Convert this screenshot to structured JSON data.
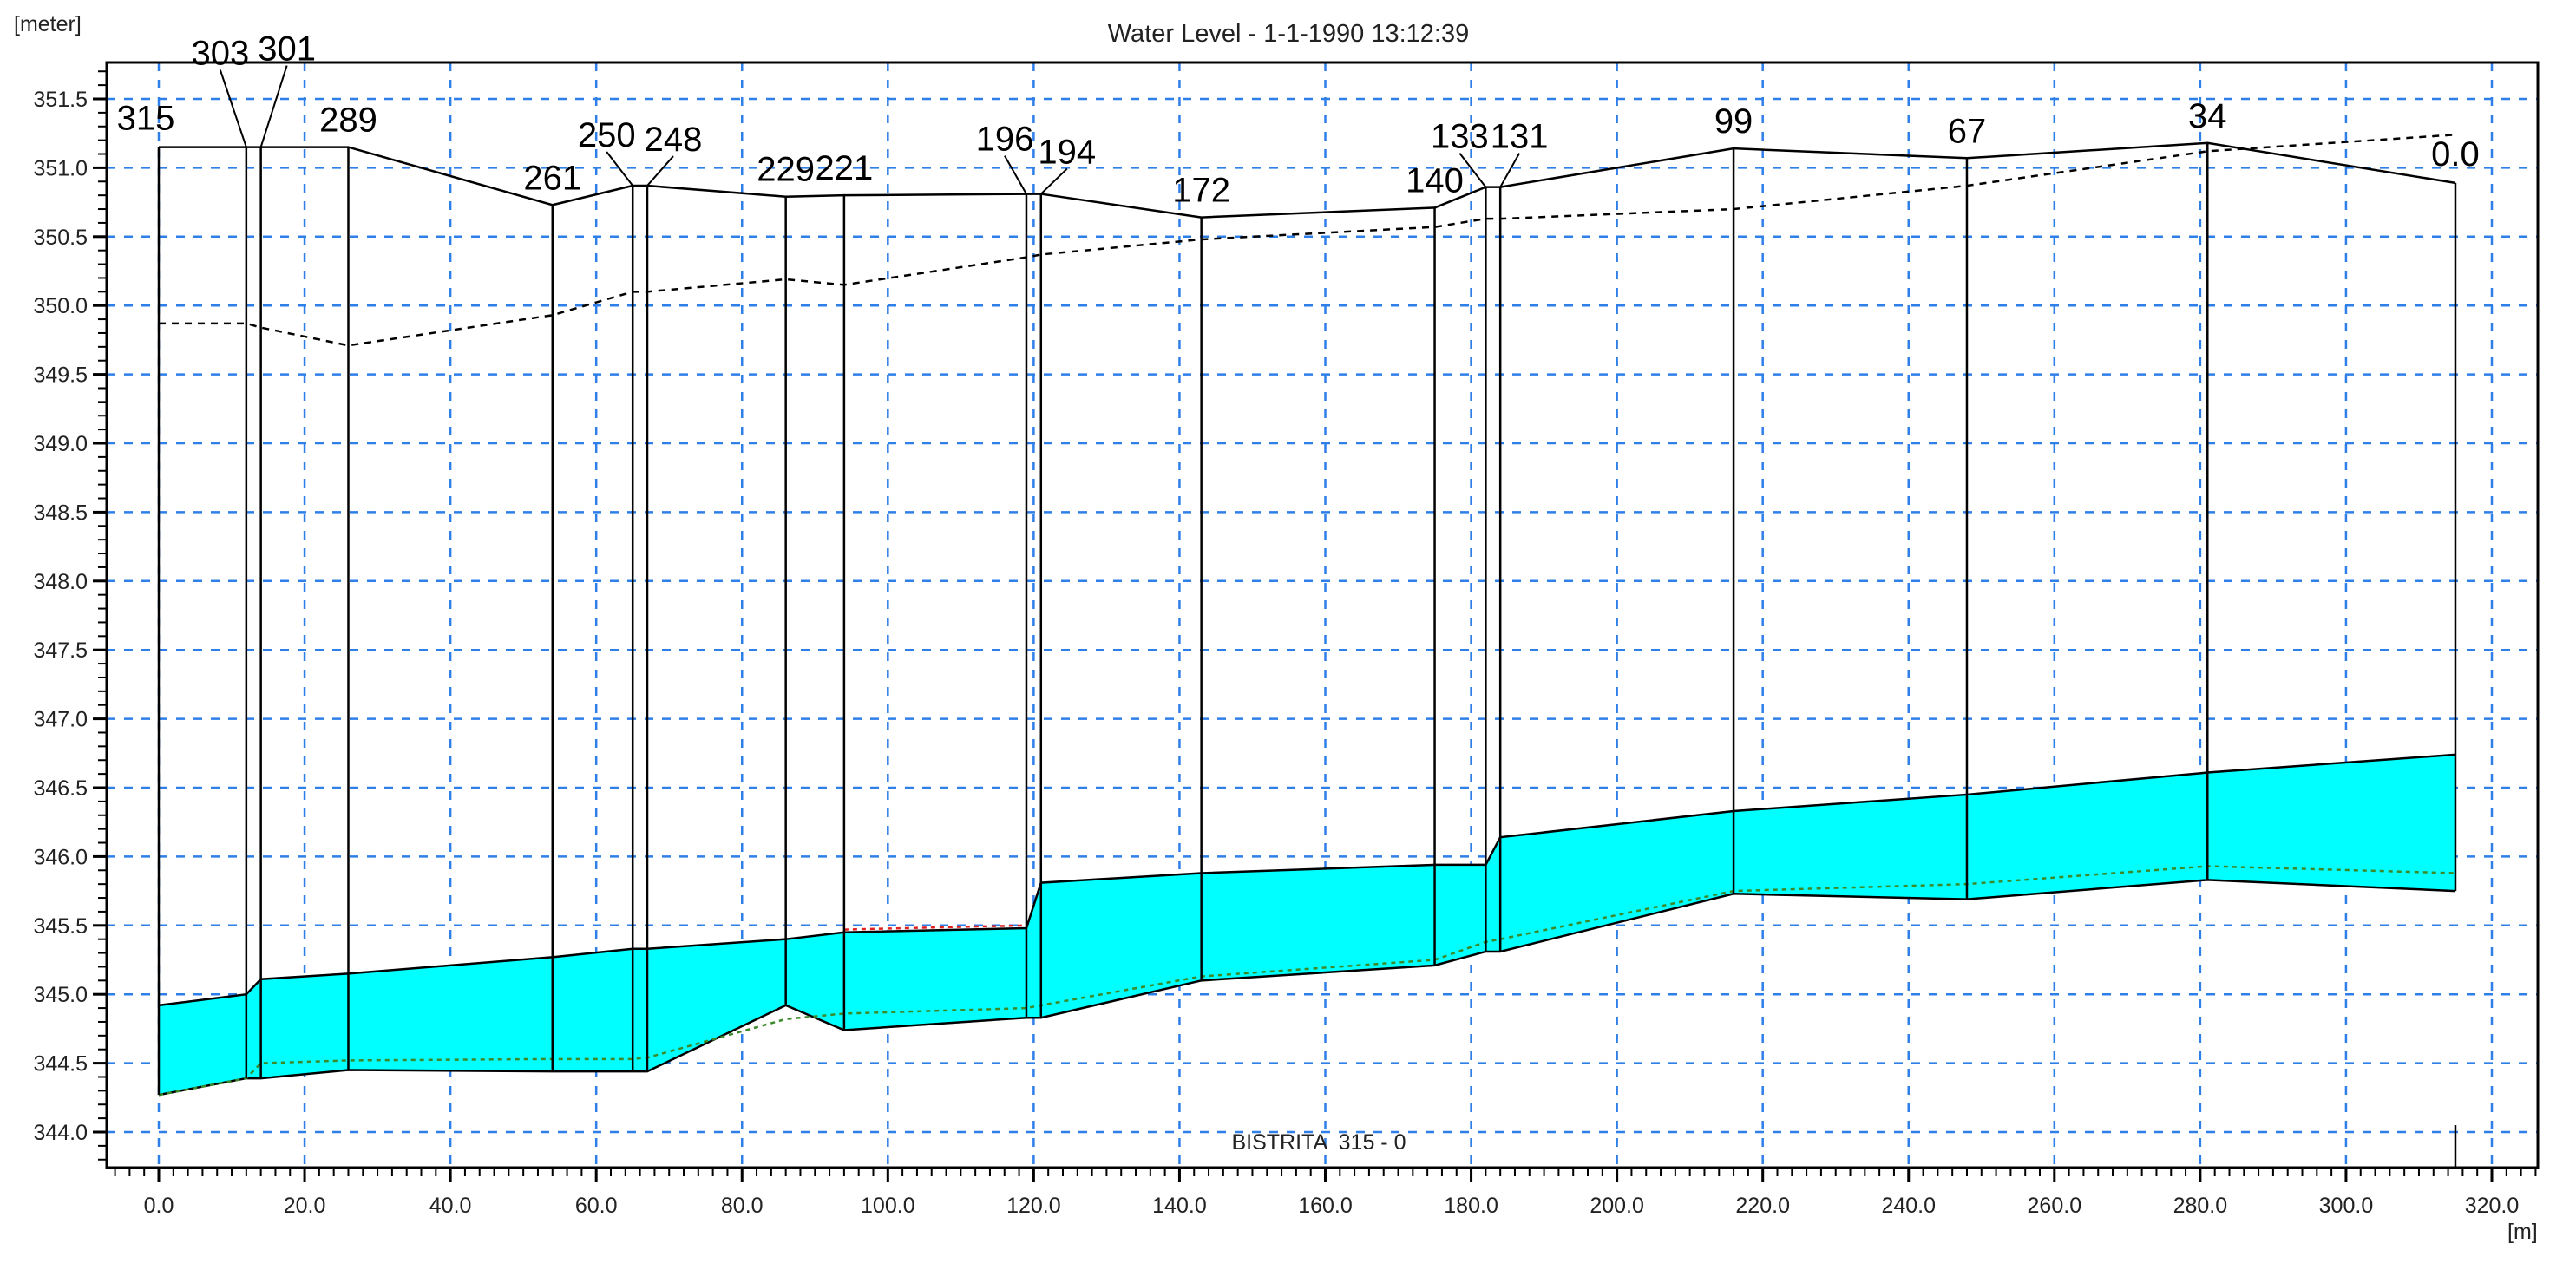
{
  "chart_data": {
    "type": "line",
    "title": "Water Level - 1-1-1990 13:12:39",
    "ylabel": "[meter]",
    "xlabel": "[m]",
    "branch_label": "BISTRITA  315 - 0",
    "xlim": [
      -7,
      326
    ],
    "ylim": [
      343.75,
      351.75
    ],
    "x_ticks": [
      "0.0",
      "20.0",
      "40.0",
      "60.0",
      "80.0",
      "100.0",
      "120.0",
      "140.0",
      "160.0",
      "180.0",
      "200.0",
      "220.0",
      "240.0",
      "260.0",
      "280.0",
      "300.0",
      "320.0"
    ],
    "x_tick_values": [
      0,
      20,
      40,
      60,
      80,
      100,
      120,
      140,
      160,
      180,
      200,
      220,
      240,
      260,
      280,
      300,
      320
    ],
    "y_ticks": [
      "344.0",
      "344.5",
      "345.0",
      "345.5",
      "346.0",
      "346.5",
      "347.0",
      "347.5",
      "348.0",
      "348.5",
      "349.0",
      "349.5",
      "350.0",
      "350.5",
      "351.0",
      "351.5"
    ],
    "y_tick_values": [
      344.0,
      344.5,
      345.0,
      345.5,
      346.0,
      346.5,
      347.0,
      347.5,
      348.0,
      348.5,
      349.0,
      349.5,
      350.0,
      350.5,
      351.0,
      351.5
    ],
    "grid": true,
    "colors": {
      "water": "#00ffff",
      "grid": "#2f7fe8",
      "bed2": "#3a8a2a",
      "red": "#e02020"
    },
    "stations": [
      {
        "label": "315",
        "x": 0,
        "bank_left": 351.15,
        "bank_right": 349.87,
        "water": 344.92,
        "bed": 344.27,
        "bed2": 344.27
      },
      {
        "label": "303",
        "x": 12,
        "bank_left": 351.15,
        "bank_right": 349.87,
        "water": 345.0,
        "bed": 344.39,
        "bed2": 344.39
      },
      {
        "label": "301",
        "x": 14,
        "bank_left": 351.15,
        "bank_right": 349.84,
        "water": 345.11,
        "bed": 344.39,
        "bed2": 344.5
      },
      {
        "label": "289",
        "x": 26,
        "bank_left": 351.15,
        "bank_right": 349.71,
        "water": 345.15,
        "bed": 344.45,
        "bed2": 344.52
      },
      {
        "label": "261",
        "x": 54,
        "bank_left": 350.73,
        "bank_right": 349.93,
        "water": 345.27,
        "bed": 344.44,
        "bed2": 344.53
      },
      {
        "label": "250",
        "x": 65,
        "bank_left": 350.87,
        "bank_right": 350.1,
        "water": 345.33,
        "bed": 344.44,
        "bed2": 344.53
      },
      {
        "label": "248",
        "x": 67,
        "bank_left": 350.87,
        "bank_right": 350.1,
        "water": 345.33,
        "bed": 344.44,
        "bed2": 344.54
      },
      {
        "label": "229",
        "x": 86,
        "bank_left": 350.79,
        "bank_right": 350.19,
        "water": 345.4,
        "bed": 344.92,
        "bed2": 344.82
      },
      {
        "label": "221",
        "x": 94,
        "bank_left": 350.8,
        "bank_right": 350.15,
        "water": 345.45,
        "bed": 344.74,
        "bed2": 344.86
      },
      {
        "label": "196",
        "x": 119,
        "bank_left": 350.81,
        "bank_right": 350.35,
        "water": 345.48,
        "bed": 344.83,
        "bed2": 344.9
      },
      {
        "label": "194",
        "x": 121,
        "bank_left": 350.81,
        "bank_right": 350.37,
        "water": 345.81,
        "bed": 344.83,
        "bed2": 344.92
      },
      {
        "label": "172",
        "x": 143,
        "bank_left": 350.64,
        "bank_right": 350.48,
        "water": 345.88,
        "bed": 345.1,
        "bed2": 345.13
      },
      {
        "label": "140",
        "x": 175,
        "bank_left": 350.71,
        "bank_right": 350.57,
        "water": 345.94,
        "bed": 345.21,
        "bed2": 345.25
      },
      {
        "label": "133",
        "x": 182,
        "bank_left": 350.86,
        "bank_right": 350.63,
        "water": 345.94,
        "bed": 345.31,
        "bed2": 345.38
      },
      {
        "label": "131",
        "x": 184,
        "bank_left": 350.86,
        "bank_right": 350.63,
        "water": 346.14,
        "bed": 345.31,
        "bed2": 345.4
      },
      {
        "label": "99",
        "x": 216,
        "bank_left": 351.14,
        "bank_right": 350.7,
        "water": 346.33,
        "bed": 345.73,
        "bed2": 345.75
      },
      {
        "label": "67",
        "x": 248,
        "bank_left": 351.07,
        "bank_right": 350.87,
        "water": 346.45,
        "bed": 345.69,
        "bed2": 345.8
      },
      {
        "label": "34",
        "x": 281,
        "bank_left": 351.18,
        "bank_right": 351.12,
        "water": 346.61,
        "bed": 345.83,
        "bed2": 345.93
      },
      {
        "label": "0.0",
        "x": 315,
        "bank_left": 350.89,
        "bank_right": 351.24,
        "water": 346.74,
        "bed": 345.75,
        "bed2": 345.88
      }
    ],
    "red_segment": {
      "x": [
        94,
        119
      ],
      "y": [
        345.47,
        345.5
      ]
    }
  }
}
